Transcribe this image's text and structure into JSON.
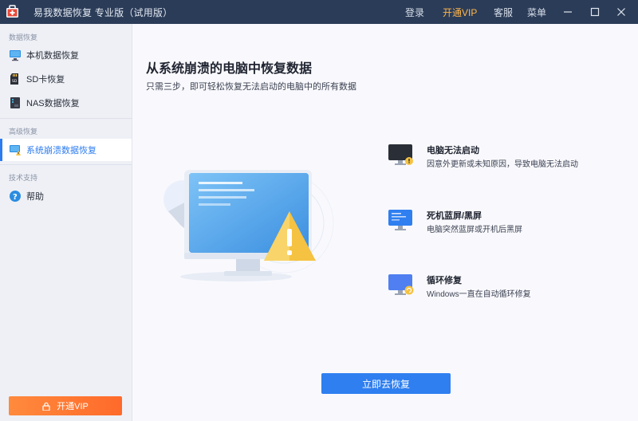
{
  "titlebar": {
    "app_title": "易我数据恢复 专业版（试用版）",
    "login": "登录",
    "vip": "开通VIP",
    "service": "客服",
    "menu": "菜单"
  },
  "sidebar": {
    "sections": [
      {
        "label": "数据恢复"
      },
      {
        "label": "高级恢复"
      },
      {
        "label": "技术支持"
      }
    ],
    "items": [
      {
        "label": "本机数据恢复",
        "icon": "monitor-icon"
      },
      {
        "label": "SD卡恢复",
        "icon": "sd-card-icon"
      },
      {
        "label": "NAS数据恢复",
        "icon": "nas-icon"
      },
      {
        "label": "系统崩溃数据恢复",
        "icon": "system-crash-icon",
        "active": true
      },
      {
        "label": "帮助",
        "icon": "help-icon"
      }
    ],
    "vip_button": "开通VIP"
  },
  "main": {
    "title": "从系统崩溃的电脑中恢复数据",
    "subtitle": "只需三步，即可轻松恢复无法启动的电脑中的所有数据",
    "causes": [
      {
        "title": "电脑无法启动",
        "desc": "因意外更新或未知原因，导致电脑无法启动",
        "icon": "black-screen-monitor-icon"
      },
      {
        "title": "死机蓝屏/黑屏",
        "desc": "电脑突然蓝屏或开机后黑屏",
        "icon": "blue-screen-monitor-icon"
      },
      {
        "title": "循环修复",
        "desc": "Windows一直在自动循环修复",
        "icon": "repair-loop-monitor-icon"
      }
    ],
    "action_button": "立即去恢复"
  },
  "colors": {
    "titlebar": "#2b3c58",
    "accent": "#2f7ff0",
    "vip_orange": "#ff7a33",
    "warning": "#f5c242"
  }
}
